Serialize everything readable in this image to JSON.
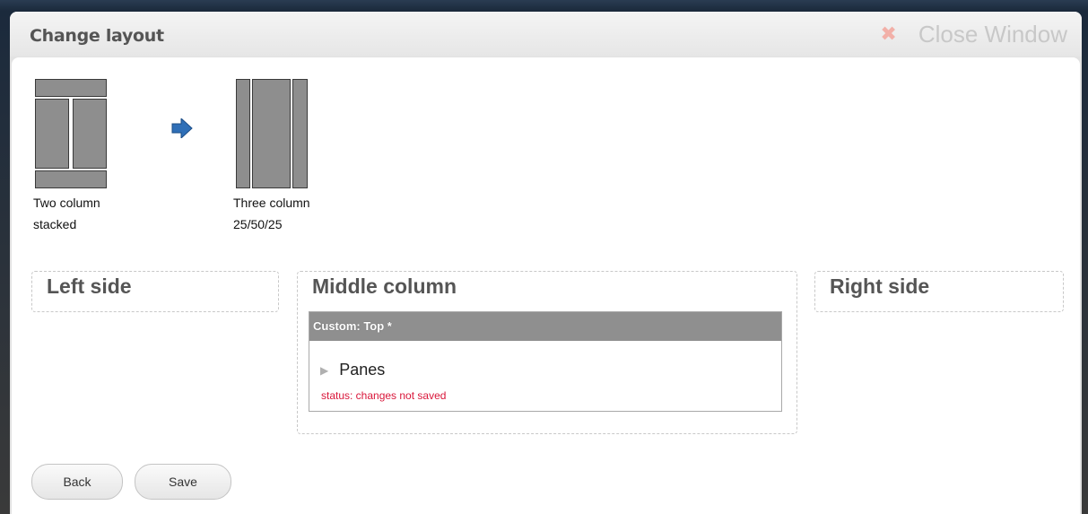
{
  "dialog": {
    "title": "Change layout",
    "close_label": "Close Window",
    "close_icon": "close-x-icon"
  },
  "layouts": {
    "current": {
      "label_line1": "Two column",
      "label_line2": "stacked"
    },
    "arrow_icon": "arrow-right-icon",
    "new": {
      "label_line1": "Three column",
      "label_line2": "25/50/25"
    }
  },
  "regions": {
    "left": {
      "title": "Left side"
    },
    "middle": {
      "title": "Middle column",
      "pane": {
        "header": "Custom: Top *",
        "item_label": "Panes",
        "status": "status: changes not saved"
      }
    },
    "right": {
      "title": "Right side"
    }
  },
  "buttons": {
    "back": "Back",
    "save": "Save"
  },
  "colors": {
    "status": "#d9163a",
    "arrow": "#2f6fb7",
    "pane_header": "#8f8f8f"
  }
}
